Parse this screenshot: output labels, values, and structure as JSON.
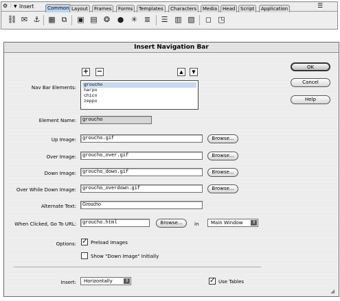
{
  "insert_panel": {
    "title": "Insert",
    "tabs": [
      {
        "label": "Common",
        "active": true
      },
      {
        "label": "Layout"
      },
      {
        "label": "Frames"
      },
      {
        "label": "Forms"
      },
      {
        "label": "Templates"
      },
      {
        "label": "Characters"
      },
      {
        "label": "Media"
      },
      {
        "label": "Head"
      },
      {
        "label": "Script"
      },
      {
        "label": "Application"
      }
    ],
    "icons": [
      "hyperlink-icon",
      "email-link-icon",
      "named-anchor-icon",
      "table-icon",
      "layer-icon",
      "image-icon",
      "image-placeholder-icon",
      "fireworks-html-icon",
      "flash-icon",
      "rollover-image-icon",
      "navigation-bar-icon",
      "horizontal-rule-icon",
      "date-icon",
      "tabular-data-icon",
      "comment-icon",
      "tag-chooser-icon"
    ]
  },
  "dialog": {
    "title": "Insert Navigation Bar",
    "buttons": {
      "ok": "OK",
      "cancel": "Cancel",
      "help": "Help"
    },
    "add_symbol": "+",
    "remove_symbol": "−",
    "nav_bar_elements_label": "Nav Bar Elements:",
    "nav_bar_elements": [
      "groucho",
      "harpo",
      "chico",
      "zeppo"
    ],
    "selected_element": "groucho",
    "element_name_label": "Element Name:",
    "element_name": "groucho",
    "up_image_label": "Up Image:",
    "up_image": "groucho.gif",
    "over_image_label": "Over Image:",
    "over_image": "groucho_over.gif",
    "down_image_label": "Down Image:",
    "down_image": "groucho_down.gif",
    "over_while_down_label": "Over While Down Image:",
    "over_while_down": "groucho_overdown.gif",
    "browse_label": "Browse...",
    "alternate_text_label": "Alternate Text:",
    "alternate_text": "Groucho",
    "when_clicked_label": "When Clicked, Go To URL:",
    "when_clicked_url": "groucho.html",
    "in_label": "in",
    "target_window": "Main Window",
    "options_label": "Options:",
    "preload_images_label": "Preload Images",
    "preload_images_checked": true,
    "show_down_image_label": "Show \"Down Image\" Initially",
    "show_down_image_checked": false,
    "insert_label": "Insert:",
    "insert_value": "Horizontally",
    "use_tables_label": "Use Tables",
    "use_tables_checked": true
  }
}
